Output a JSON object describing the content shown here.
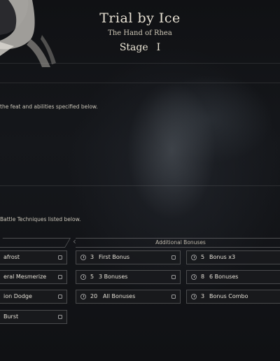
{
  "header": {
    "title": "Trial by Ice",
    "subtitle": "The Hand of Rhea",
    "stage_label": "Stage",
    "stage_number": "I"
  },
  "descriptions": {
    "top": "the feat and abilities specified below.",
    "bottom": "Battle Techniques listed below."
  },
  "sections": {
    "additional_bonuses": "Additional Bonuses"
  },
  "techniques": [
    {
      "label": "afrost"
    },
    {
      "label": "eral Mesmerize"
    },
    {
      "label": "ion Dodge"
    },
    {
      "label": "Burst"
    }
  ],
  "bonuses": [
    {
      "count": "3",
      "label": "First Bonus"
    },
    {
      "count": "5",
      "label": "Bonus x3"
    },
    {
      "count": "5",
      "label": "3 Bonuses"
    },
    {
      "count": "8",
      "label": "6 Bonuses"
    },
    {
      "count": "20",
      "label": "All Bonuses"
    },
    {
      "count": "3",
      "label": "Bonus Combo"
    }
  ],
  "colors": {
    "text_primary": "#e8e2d4",
    "card_border": "#8a8a8a",
    "background": "#111216"
  }
}
